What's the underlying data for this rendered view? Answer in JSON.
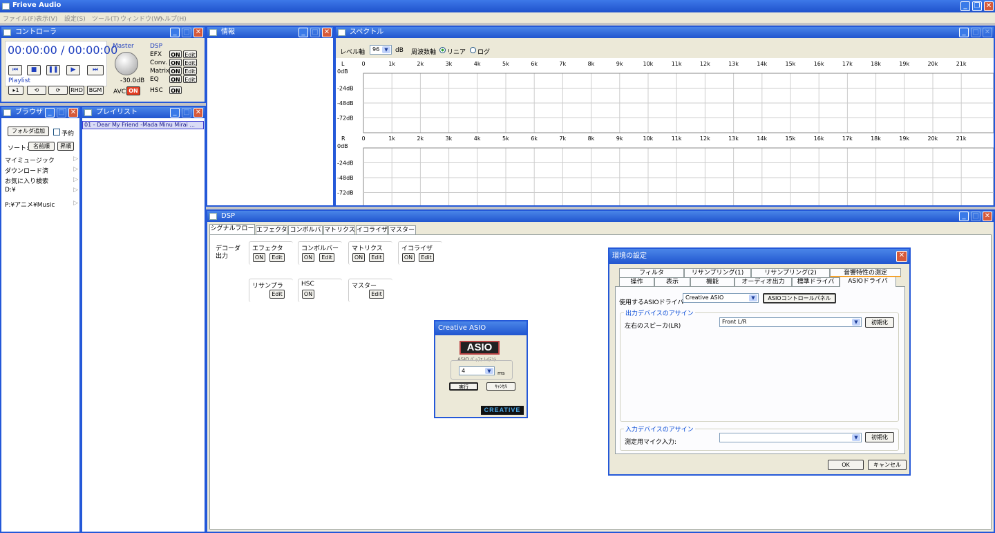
{
  "app": {
    "title": "Frieve Audio"
  },
  "menu": [
    "ファイル(F)",
    "表示(V)",
    "設定(S)",
    "ツール(T)",
    "ウィンドウ(W)",
    "ヘルプ(H)"
  ],
  "controller": {
    "title": "コントローラ",
    "time": "00:00:00 / 00:00:00",
    "master_label": "Master",
    "master_db": "-30.0dB",
    "playlist_label": "Playlist",
    "btn_one": "▸1",
    "btn_rhd": "RHD",
    "btn_bgm": "BGM",
    "avc_label": "AVC",
    "avc_state": "ON",
    "dsp_label": "DSP",
    "dsp_rows": [
      {
        "label": "EFX",
        "state": "ON",
        "edit": "Edit"
      },
      {
        "label": "Conv.",
        "state": "ON",
        "edit": "Edit"
      },
      {
        "label": "Matrix",
        "state": "ON",
        "edit": "Edit"
      },
      {
        "label": "EQ",
        "state": "ON",
        "edit": "Edit"
      },
      {
        "label": "HSC",
        "state": "ON",
        "edit": ""
      }
    ]
  },
  "info": {
    "title": "情報"
  },
  "browser": {
    "title": "ブラウザ",
    "add_folder": "フォルダ追加",
    "reserve": "予約",
    "sort_label": "ソート:",
    "sort_name": "名前順",
    "sort_asc": "昇順",
    "items": [
      "マイミュージック",
      "ダウンロード済",
      "お気に入り検索",
      "D:¥",
      "P:¥アニメ¥Music"
    ]
  },
  "playlist": {
    "title": "プレイリスト",
    "items": [
      "01 - Dear My Friend -Mada Minu Mirai ..."
    ]
  },
  "spectrum": {
    "title": "スペクトル",
    "level_label": "レベル軸",
    "level_value": "96",
    "level_unit": "dB",
    "freq_label": "周波数軸",
    "linear": "リニア",
    "log": "ログ",
    "freq_ticks": [
      "0",
      "1k",
      "2k",
      "3k",
      "4k",
      "5k",
      "6k",
      "7k",
      "8k",
      "9k",
      "10k",
      "11k",
      "12k",
      "13k",
      "14k",
      "15k",
      "16k",
      "17k",
      "18k",
      "19k",
      "20k",
      "21k"
    ],
    "db_ticks": [
      "0dB",
      "-24dB",
      "-48dB",
      "-72dB"
    ],
    "channels": [
      "L",
      "R"
    ]
  },
  "dsp": {
    "title": "DSP",
    "tabs": [
      "シグナルフロー",
      "エフェクタ",
      "コンボルバ",
      "マトリクス",
      "イコライザ",
      "マスター"
    ],
    "decoder_label": "デコーダ\n出力",
    "blocks": [
      {
        "label": "エフェクタ",
        "on": "ON",
        "edit": "Edit"
      },
      {
        "label": "コンボルバー",
        "on": "ON",
        "edit": "Edit"
      },
      {
        "label": "マトリクス",
        "on": "ON",
        "edit": "Edit"
      },
      {
        "label": "イコライザ",
        "on": "ON",
        "edit": "Edit"
      },
      {
        "label": "リサンプラ",
        "on": "",
        "edit": "Edit"
      },
      {
        "label": "HSC",
        "on": "ON",
        "edit": ""
      },
      {
        "label": "マスター",
        "on": "",
        "edit": "Edit"
      }
    ]
  },
  "asio_panel": {
    "title": "Creative ASIO",
    "logo": "ASIO",
    "buffer_label": "ASIO ﾊﾞｯﾌｧ ﾚｲﾃﾝｼ",
    "buffer_value": "4",
    "unit": "ms",
    "run": "実行",
    "cancel": "ｷｬﾝｾﾙ",
    "brand": "CREATIVE"
  },
  "settings": {
    "title": "環境の設定",
    "tabs_row1": [
      "フィルタ",
      "リサンプリング(1)",
      "リサンプリング(2)",
      "音響特性の測定"
    ],
    "tabs_row2": [
      "操作",
      "表示",
      "機能",
      "オーディオ出力",
      "標準ドライバ",
      "ASIOドライバ"
    ],
    "driver_label": "使用するASIOドライバ",
    "driver_value": "Creative ASIO",
    "control_panel": "ASIOコントロールパネル",
    "out_group": "出力デバイスのアサイン",
    "speaker_label": "左右のスピーカ(LR)",
    "speaker_value": "Front L/R",
    "init": "初期化",
    "in_group": "入力デバイスのアサイン",
    "mic_label": "測定用マイク入力:",
    "mic_value": "",
    "ok": "OK",
    "cancel": "キャンセル"
  },
  "colors": {
    "title_bar": "#2155cf",
    "face": "#ece9d8",
    "avc_on": "#e43c20",
    "time": "#1f3fbf"
  }
}
